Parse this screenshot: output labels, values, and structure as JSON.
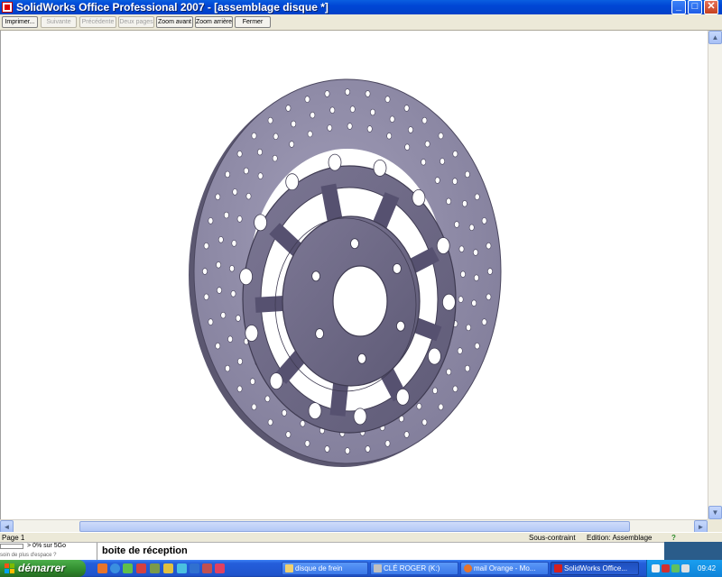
{
  "window": {
    "title": "SolidWorks Office Professional 2007 - [assemblage disque *]",
    "minimize_glyph": "_",
    "maximize_glyph": "□",
    "close_glyph": "✕"
  },
  "toolbar": {
    "print": "Imprimer...",
    "next": "Suivante",
    "previous": "Précédente",
    "two_pages": "Deux pages",
    "zoom_in": "Zoom avant",
    "zoom_out": "Zoom arrière",
    "close": "Fermer"
  },
  "scroll": {
    "up": "▲",
    "down": "▼",
    "left": "◄",
    "right": "►"
  },
  "status": {
    "page": "Page 1",
    "constraint": "Sous-contraint",
    "mode": "Edition: Assemblage",
    "help": "?"
  },
  "background_mail": {
    "quota_prefix": "> ",
    "quota": "0% sur 5Go",
    "tip": "soin de plus d'espace ?",
    "inbox": "boite de réception"
  },
  "taskbar": {
    "start": "démarrer",
    "tasks": [
      {
        "label": "disque de frein"
      },
      {
        "label": "CLÉ ROGER (K:)"
      },
      {
        "label": "mail Orange - Mo..."
      },
      {
        "label": "SolidWorks Office..."
      }
    ],
    "clock": "09:42"
  },
  "colors": {
    "disc_face": "#8e8aa6",
    "disc_edge": "#5b5770",
    "carrier_face": "#6f6a86",
    "titlebar": "#0046d5",
    "taskbar": "#245edb"
  }
}
